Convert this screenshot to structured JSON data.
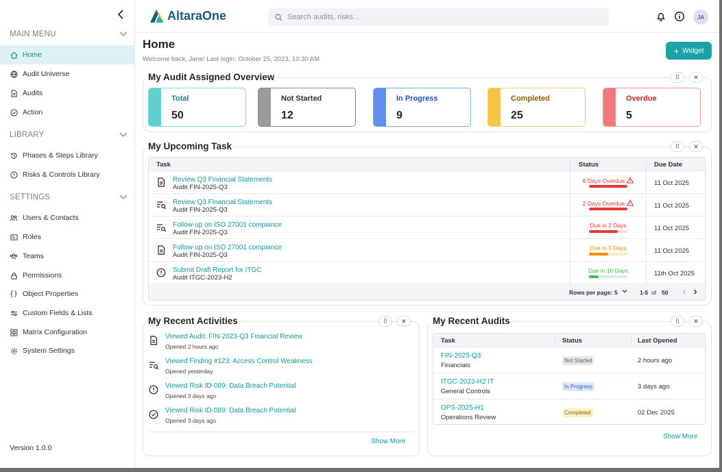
{
  "sidebar": {
    "sections": [
      {
        "label": "MAIN MENU",
        "items": [
          {
            "label": "Home",
            "icon": "home-icon",
            "active": true
          },
          {
            "label": "Audit Universe",
            "icon": "globe-icon"
          },
          {
            "label": "Audits",
            "icon": "document-icon"
          },
          {
            "label": "Action",
            "icon": "check-circle-icon"
          }
        ]
      },
      {
        "label": "LIBRARY",
        "items": [
          {
            "label": "Phases & Steps Library",
            "icon": "history-icon"
          },
          {
            "label": "Risks & Controls Library",
            "icon": "alert-circle-icon"
          }
        ]
      },
      {
        "label": "SETTINGS",
        "items": [
          {
            "label": "Users & Contacts",
            "icon": "users-icon"
          },
          {
            "label": "Roles",
            "icon": "id-card-icon"
          },
          {
            "label": "Teams",
            "icon": "team-icon"
          },
          {
            "label": "Permissions",
            "icon": "lock-icon"
          },
          {
            "label": "Object Properties",
            "icon": "braces-icon"
          },
          {
            "label": "Custom Fields & Lists",
            "icon": "sliders-icon"
          },
          {
            "label": "Matrix Configuration",
            "icon": "grid-icon"
          },
          {
            "label": "System Settings",
            "icon": "gear-icon"
          }
        ]
      }
    ],
    "version": "Version 1.0.0"
  },
  "header": {
    "brand": "AltaraOne",
    "search_placeholder": "Search audits, risks...",
    "avatar": "JA"
  },
  "page": {
    "title": "Home",
    "welcome": "Welcome back, Jane! Last login: October 25, 2023, 10:30 AM",
    "widget_label": "Widget"
  },
  "overview": {
    "title": "My Audit Assigned Overview",
    "cards": [
      {
        "label": "Total",
        "value": "50",
        "accent": "#5fcfcf",
        "border": "#7ed8dc",
        "text": "#1a7f86"
      },
      {
        "label": "Not Started",
        "value": "12",
        "accent": "#9b9b9b",
        "border": "#888888",
        "text": "#2a2f35"
      },
      {
        "label": "In Progress",
        "value": "9",
        "accent": "#5b8ff0",
        "border": "#7aa5f0",
        "text": "#1e4fb2"
      },
      {
        "label": "Completed",
        "value": "25",
        "accent": "#f4c542",
        "border": "#f2cf6b",
        "text": "#8a5a00"
      },
      {
        "label": "Overdue",
        "value": "5",
        "accent": "#ef7a7a",
        "border": "#ef9a9a",
        "text": "#b3261e"
      }
    ]
  },
  "upcoming": {
    "title": "My Upcoming Task",
    "columns": [
      "Task",
      "Status",
      "Due Date"
    ],
    "rows": [
      {
        "task": "Review Q3 Financial Statements",
        "ref": "Audit FIN-2025-Q3",
        "icon": "document-icon",
        "status": "6 Days Overdue",
        "warn": true,
        "progress": 1.0,
        "color": "#e53935",
        "due": "11 Oct 2025"
      },
      {
        "task": "Review Q3 Financial Statements",
        "ref": "Audit FIN-2025-Q3",
        "icon": "list-search-icon",
        "status": "2 Days Overdue",
        "warn": true,
        "progress": 1.0,
        "color": "#e53935",
        "due": "11 Oct 2025"
      },
      {
        "task": "Follow-up on ISO 27001 compiance",
        "ref": "Audit FIN-2025-Q3",
        "icon": "list-search-icon",
        "status": "Due in 2 Days",
        "warn": false,
        "progress": 0.75,
        "color": "#e53935",
        "due": "11 Oct 2025"
      },
      {
        "task": "Follow-up on ISO 27001 compiance",
        "ref": "Audit FIN-2025-Q3",
        "icon": "document-icon",
        "status": "Due in 5 Days",
        "warn": false,
        "progress": 0.5,
        "color": "#f28c00",
        "due": "11 Oct 2025"
      },
      {
        "task": "Submit Draft Report for ITGC",
        "ref": "Audit ITGC-2023-H2",
        "icon": "alert-circle-icon",
        "status": "Due in 16 Days",
        "warn": false,
        "progress": 0.25,
        "color": "#3fb950",
        "due": "11th Oct 2025"
      }
    ],
    "pager": {
      "rows_per_page_label": "Rows per page:",
      "rows_per_page": "5",
      "range": "1-5",
      "of_label": "of",
      "total": "50"
    }
  },
  "activities": {
    "title": "My Recent Activities",
    "items": [
      {
        "text": "Viewed Audit: FIN-2023-Q3 Financial Review",
        "time": "Opened 2 hours ago",
        "icon": "document-icon"
      },
      {
        "text": "Viewed Finding #123: Access Control Weakness",
        "time": "Opened yesterday",
        "icon": "list-search-icon"
      },
      {
        "text": "Viewed Risk ID-089: Data Breach Potential",
        "time": "Opened 3 days ago",
        "icon": "alert-circle-icon"
      },
      {
        "text": "Viewed Risk ID-089: Data Breach Potential",
        "time": "Opened 3 days ago",
        "icon": "check-circle-icon"
      }
    ],
    "show_more": "Show More"
  },
  "recent_audits": {
    "title": "My Recent Audits",
    "columns": [
      "Task",
      "Status",
      "Last Opened"
    ],
    "rows": [
      {
        "code": "FIN-2025-Q3",
        "name": "Financials",
        "status": "Not Started",
        "bg": "#e6e7e9",
        "fg": "#555b63",
        "opened": "2 hours ago"
      },
      {
        "code": "ITGC-2023-H2 IT",
        "name": "General Controls",
        "status": "In Progress",
        "bg": "#dbe8fb",
        "fg": "#2b5fc2",
        "opened": "3 days ago"
      },
      {
        "code": "OPS-2025-H1",
        "name": "Operations Review",
        "status": "Completed",
        "bg": "#fbf1c9",
        "fg": "#8a6400",
        "opened": "02 Dec 2025"
      }
    ],
    "show_more": "Show More"
  }
}
